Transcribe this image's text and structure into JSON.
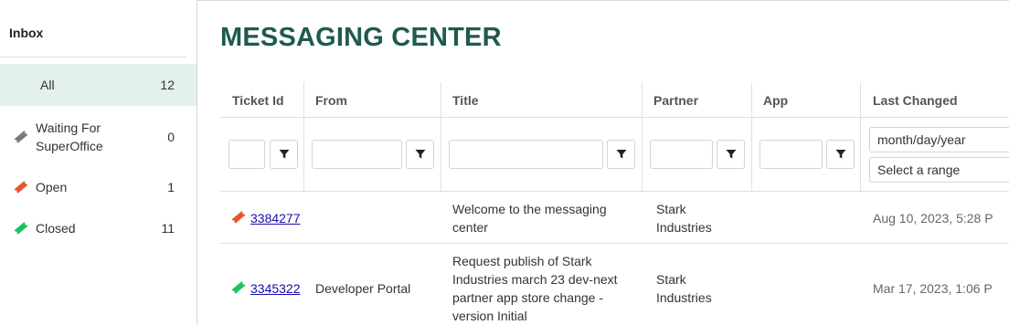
{
  "sidebar": {
    "heading": "Inbox",
    "items": [
      {
        "label": "All",
        "count": "12",
        "icon": "none",
        "active": true
      },
      {
        "label": "Waiting For SuperOffice",
        "count": "0",
        "icon": "ticket-icon",
        "color": "#7a7a7a"
      },
      {
        "label": "Open",
        "count": "1",
        "icon": "ticket-icon",
        "color": "#e4572e"
      },
      {
        "label": "Closed",
        "count": "11",
        "icon": "ticket-icon",
        "color": "#1ec25f"
      }
    ]
  },
  "main": {
    "title": "MESSAGING CENTER",
    "columns": [
      "Ticket Id",
      "From",
      "Title",
      "Partner",
      "App",
      "Last Changed"
    ],
    "filters": {
      "date_placeholder": "month/day/year",
      "range_label": "Select a range"
    },
    "rows": [
      {
        "ticket_id": "3384277",
        "status_color": "#e4572e",
        "from": "",
        "title": "Welcome to the messaging center",
        "partner": "Stark Industries",
        "app": "",
        "last_changed": "Aug 10, 2023, 5:28 P"
      },
      {
        "ticket_id": "3345322",
        "status_color": "#1ec25f",
        "from": "Developer Portal",
        "title": "Request publish of Stark Industries march 23 dev-next partner app store change - version Initial",
        "partner": "Stark Industries",
        "app": "",
        "last_changed": "Mar 17, 2023, 1:06 P"
      }
    ]
  },
  "colors": {
    "accent": "#1f5a4e",
    "active_bg": "#e4f0ea",
    "link": "#1a0dab"
  }
}
